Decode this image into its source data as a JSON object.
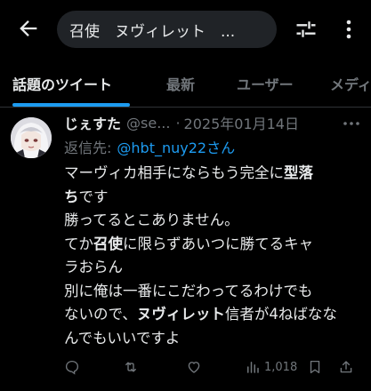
{
  "header": {
    "search_text": "召使　ヌヴィレット　..."
  },
  "tabs": [
    {
      "label": "話題のツイート",
      "active": true
    },
    {
      "label": "最新",
      "active": false
    },
    {
      "label": "ユーザー",
      "active": false
    },
    {
      "label": "メディア",
      "active": false
    }
  ],
  "tweet": {
    "display_name": "じぇすた",
    "handle": "@se...",
    "separator": "·",
    "date": "2025年01月14日",
    "reply_prefix": "返信先:",
    "reply_to": "@hbt_nuy22さん",
    "lines": [
      [
        {
          "t": "マーヴィカ相手にならもう完全に"
        },
        {
          "t": "型落",
          "b": true
        }
      ],
      [
        {
          "t": "ち",
          "b": true
        },
        {
          "t": "です"
        }
      ],
      [
        {
          "t": "勝ってるとこありません。"
        }
      ],
      [
        {
          "t": "てか"
        },
        {
          "t": "召使",
          "b": true
        },
        {
          "t": "に限らずあいつに勝てるキャ"
        }
      ],
      [
        {
          "t": "ラおらん"
        }
      ],
      [
        {
          "t": "別に俺は一番にこだわってるわけでも"
        }
      ],
      [
        {
          "t": "ないので、"
        },
        {
          "t": "ヌヴィレット",
          "b": true
        },
        {
          "t": "信者が4ねばなな"
        }
      ],
      [
        {
          "t": "んでもいいですよ"
        }
      ]
    ],
    "stats": {
      "views": "1,018"
    }
  },
  "colors": {
    "background": "#000000",
    "text": "#e7e9ea",
    "muted": "#71767b",
    "accent": "#1d9bf0",
    "search_bg": "#202327",
    "divider": "#2f3336"
  },
  "icons": [
    "back-arrow-icon",
    "filter-sliders-icon",
    "more-vertical-icon",
    "more-horizontal-icon",
    "reply-icon",
    "retweet-icon",
    "like-icon",
    "views-icon",
    "bookmark-icon",
    "share-icon"
  ]
}
